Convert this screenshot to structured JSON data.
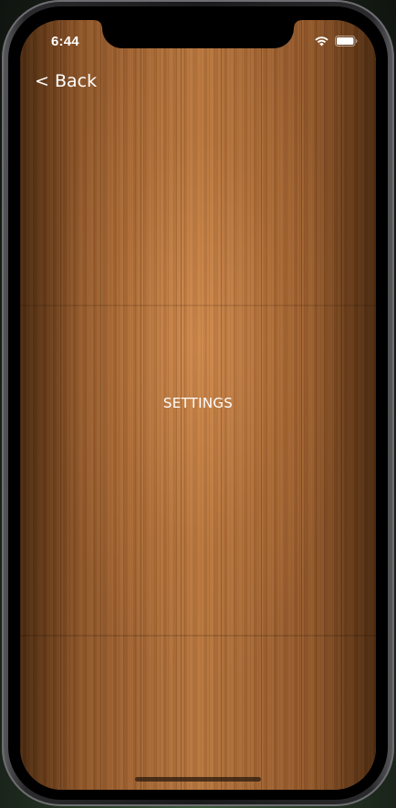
{
  "status_bar": {
    "time": "6:44",
    "wifi_icon": "wifi-icon",
    "battery_icon": "battery-icon"
  },
  "nav": {
    "back_label": "< Back"
  },
  "screen": {
    "title": "SETTINGS",
    "background": "wood-planks",
    "text_color": "#ffffff"
  }
}
